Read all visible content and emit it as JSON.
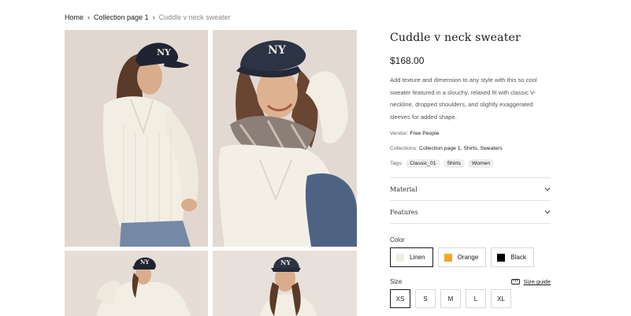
{
  "breadcrumb": {
    "items": [
      "Home",
      "Collection page 1"
    ],
    "current": "Cuddle v neck sweater",
    "separator": ">"
  },
  "gallery": {
    "images": [
      {
        "alt": "Model in cream v neck sweater and navy NY cap, looking over shoulder"
      },
      {
        "alt": "Model smiling in cream v neck sweater with plaid scarf"
      },
      {
        "alt": "Model in cream sweater and NY cap, arms raised"
      },
      {
        "alt": "Model in cream sweater and NY cap, close up"
      }
    ]
  },
  "product": {
    "title": "Cuddle v neck sweater",
    "price": "$168.00",
    "description": "Add texture and dimension to any style with this so cool sweater featured in a slouchy, relaxed fit with classic V-neckline, dropped shoulders, and slightly exaggerated sleeves for added shape.",
    "vendor_label": "Vendor:",
    "vendor": "Free People",
    "collections_label": "Collections:",
    "collections": "Collection page 1, Shirts, Sweaters",
    "tags_label": "Tags:",
    "tags": [
      "Classic_01",
      "Shirts",
      "Women"
    ]
  },
  "accordion": {
    "material": "Material",
    "features": "Features"
  },
  "options": {
    "color_label": "Color",
    "colors": [
      {
        "name": "Linen",
        "swatch": "#f1ece3",
        "selected": true
      },
      {
        "name": "Orange",
        "swatch": "#f5a623",
        "selected": false
      },
      {
        "name": "Black",
        "swatch": "#000000",
        "selected": false
      }
    ],
    "size_label": "Size",
    "size_guide": "Size guide",
    "sizes": [
      "XS",
      "S",
      "M",
      "L",
      "XL"
    ],
    "selected_size": "XS"
  }
}
